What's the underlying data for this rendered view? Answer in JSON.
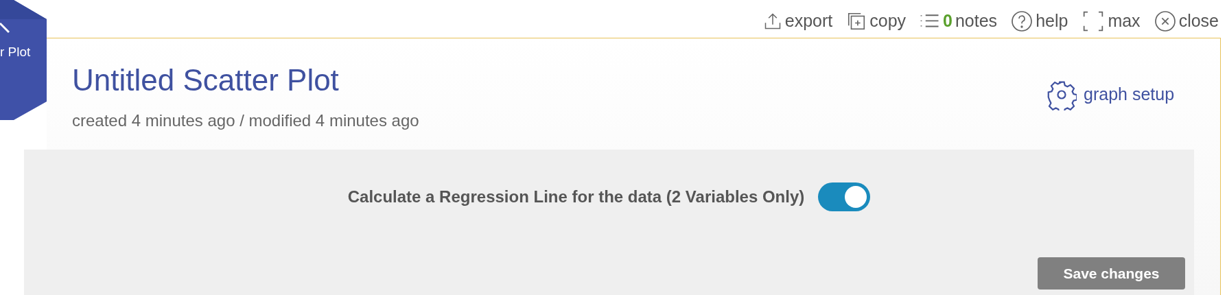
{
  "toolbar": [
    {
      "kind": "export",
      "label": "export"
    },
    {
      "kind": "copy",
      "label": "copy"
    },
    {
      "kind": "notes",
      "count": "0",
      "label": "notes"
    },
    {
      "kind": "help",
      "label": "help"
    },
    {
      "kind": "max",
      "label": "max"
    },
    {
      "kind": "close",
      "label": "close"
    }
  ],
  "badge": {
    "label": "r Plot"
  },
  "title": "Untitled Scatter Plot",
  "subtitle": "created 4 minutes ago / modified 4 minutes ago",
  "setup": {
    "label": "graph setup"
  },
  "option": {
    "label": "Calculate a Regression Line for the data (2 Variables Only)",
    "on": true
  },
  "save": {
    "label": "Save changes"
  }
}
